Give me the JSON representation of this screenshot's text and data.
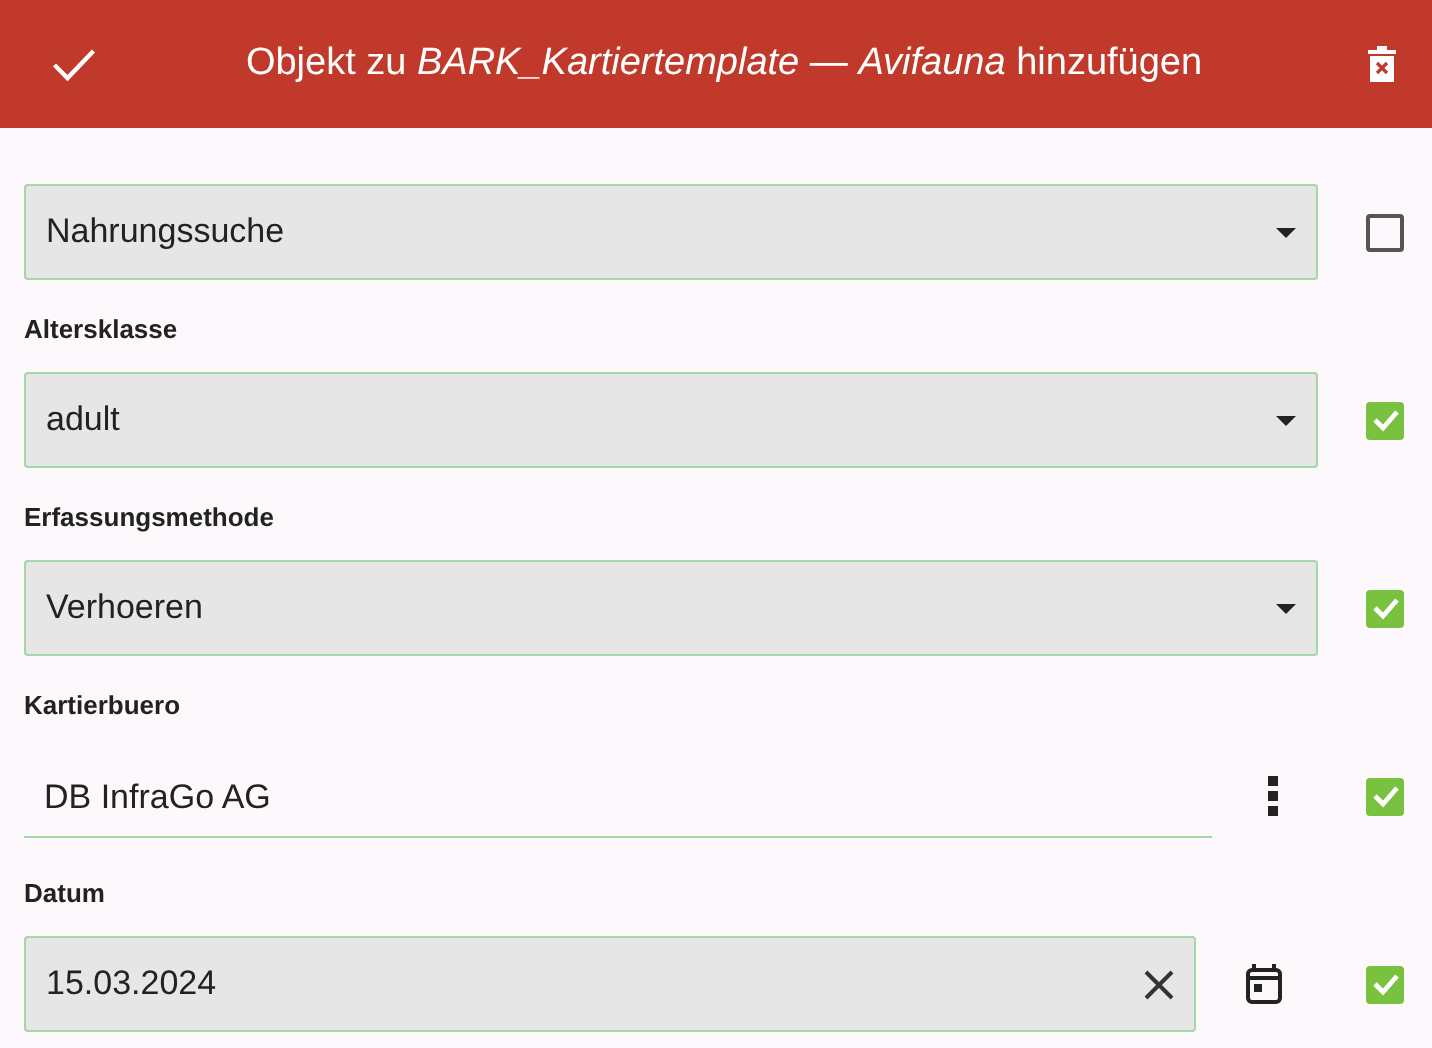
{
  "header": {
    "title": "Objekt zu *BARK_Kartiertemplate* — *Avifauna* hinzufügen"
  },
  "fields": [
    {
      "kind": "dropdown",
      "value": "Nahrungssuche",
      "checked": false
    },
    {
      "kind": "dropdown",
      "label": "Altersklasse",
      "value": "adult",
      "checked": true
    },
    {
      "kind": "dropdown",
      "label": "Erfassungsmethode",
      "value": "Verhoeren",
      "checked": true
    },
    {
      "kind": "text",
      "label": "Kartierbuero",
      "value": "DB InfraGo AG",
      "checked": true
    },
    {
      "kind": "date",
      "label": "Datum",
      "value": "15.03.2024",
      "checked": true
    }
  ]
}
